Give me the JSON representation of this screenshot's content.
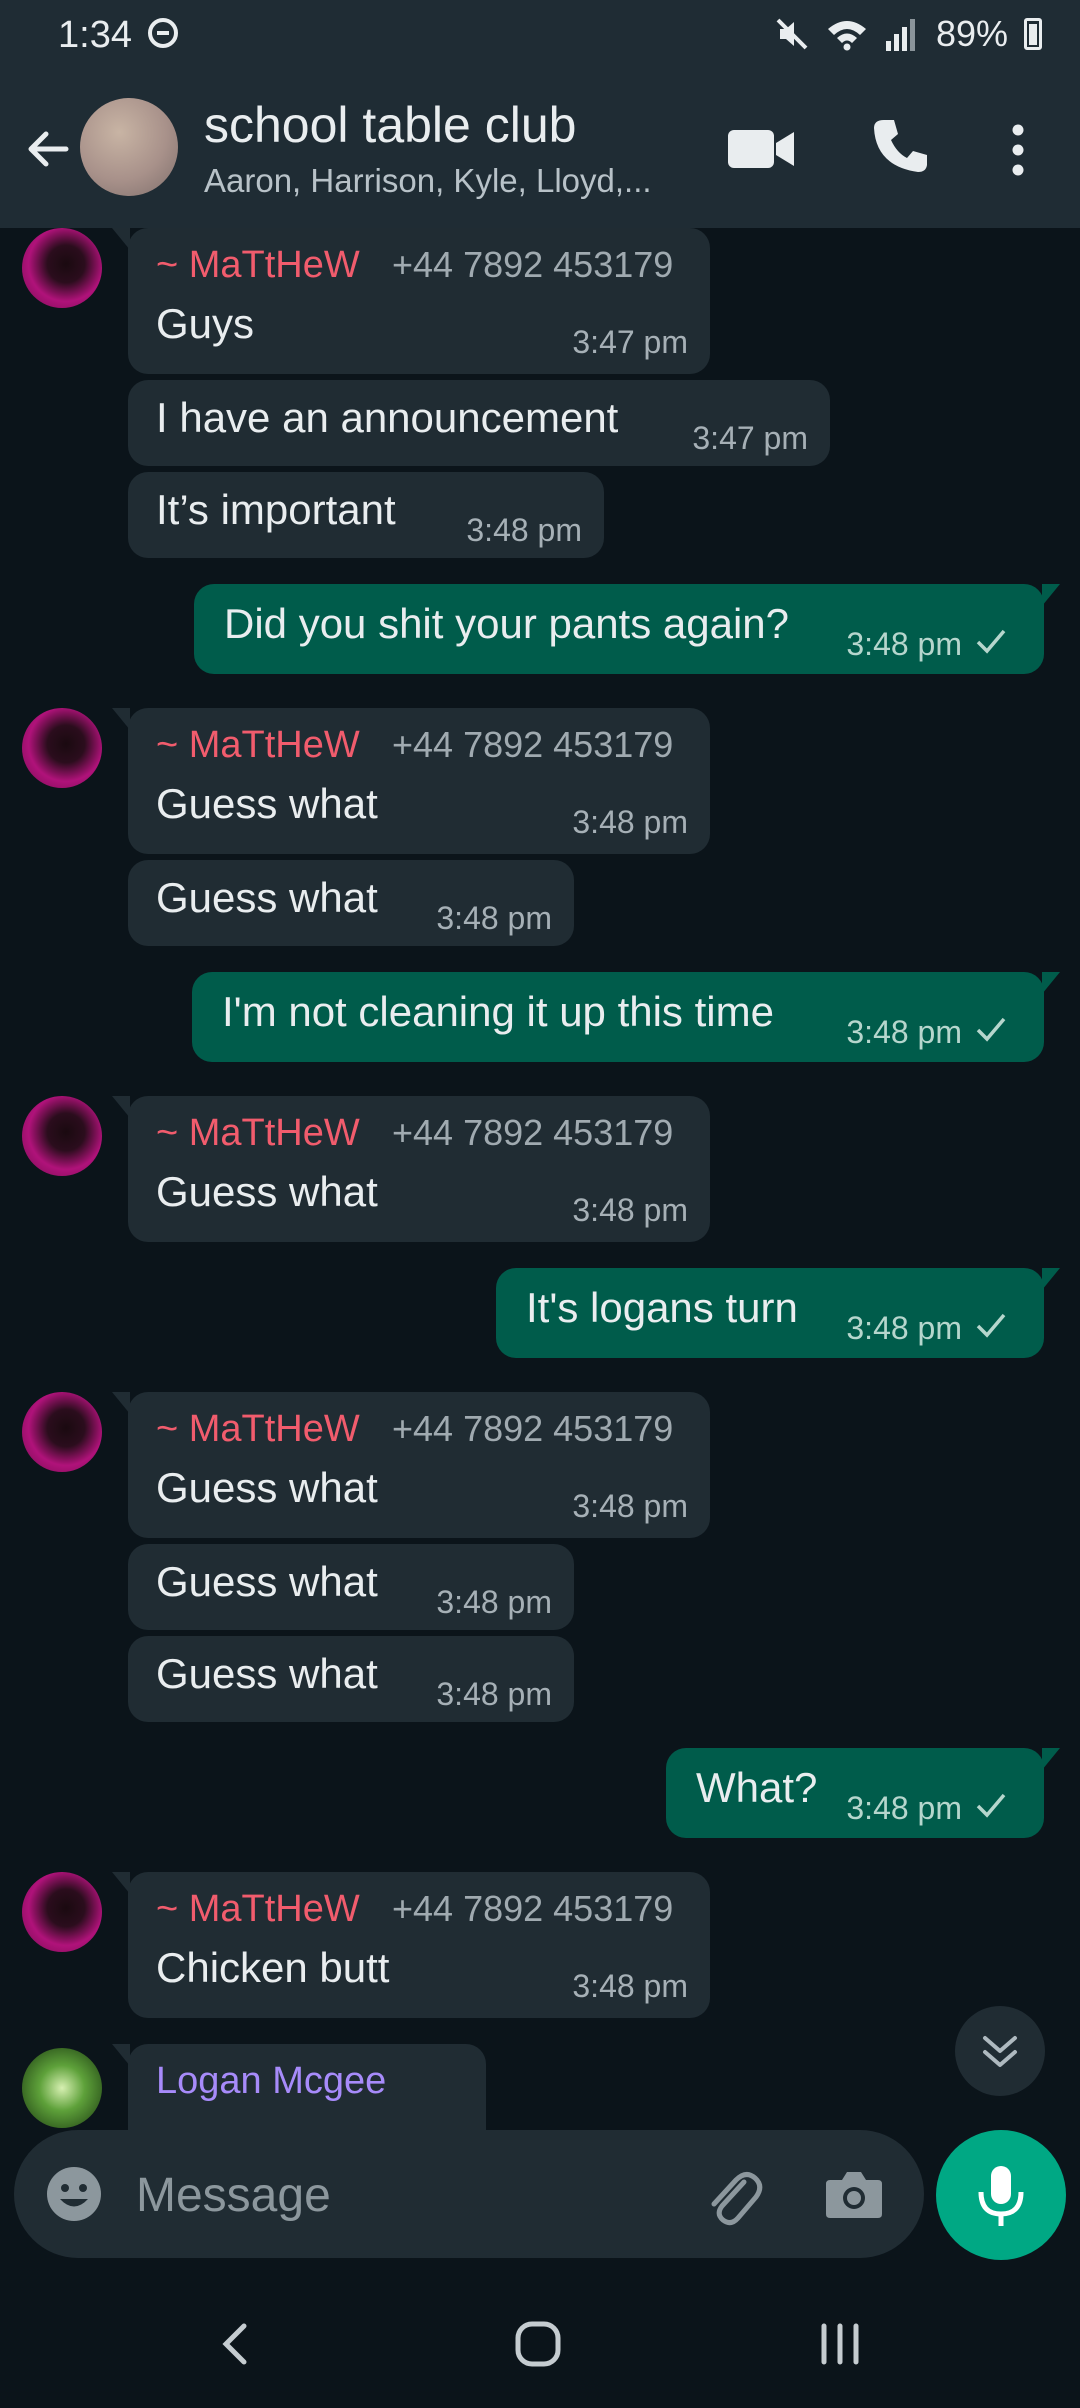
{
  "status_bar": {
    "time": "1:34",
    "battery": "89%"
  },
  "header": {
    "title": "school table club",
    "subtitle": "Aaron, Harrison, Kyle, Lloyd,..."
  },
  "messages": [
    {
      "dir": "in",
      "sender": "~ MaTtHeW",
      "phone": "+44 7892 453179",
      "text": "Guys",
      "time": "3:47 pm"
    },
    {
      "dir": "in",
      "text": "I have an announcement",
      "time": "3:47 pm"
    },
    {
      "dir": "in",
      "text": "It’s important",
      "time": "3:48 pm"
    },
    {
      "dir": "out",
      "text": "Did you shit your pants again?",
      "time": "3:48 pm"
    },
    {
      "dir": "in",
      "sender": "~ MaTtHeW",
      "phone": "+44 7892 453179",
      "text": "Guess what",
      "time": "3:48 pm"
    },
    {
      "dir": "in",
      "text": "Guess what",
      "time": "3:48 pm"
    },
    {
      "dir": "out",
      "text": "I'm not cleaning it up this time",
      "time": "3:48 pm"
    },
    {
      "dir": "in",
      "sender": "~ MaTtHeW",
      "phone": "+44 7892 453179",
      "text": "Guess what",
      "time": "3:48 pm"
    },
    {
      "dir": "out",
      "text": "It's logans turn",
      "time": "3:48 pm"
    },
    {
      "dir": "in",
      "sender": "~ MaTtHeW",
      "phone": "+44 7892 453179",
      "text": "Guess what",
      "time": "3:48 pm"
    },
    {
      "dir": "in",
      "text": "Guess what",
      "time": "3:48 pm"
    },
    {
      "dir": "in",
      "text": "Guess what",
      "time": "3:48 pm"
    },
    {
      "dir": "out",
      "text": "What?",
      "time": "3:48 pm"
    },
    {
      "dir": "in",
      "sender": "~ MaTtHeW",
      "phone": "+44 7892 453179",
      "text": "Chicken butt",
      "time": "3:48 pm"
    }
  ],
  "partial_sender": "Logan Mcgee",
  "input": {
    "placeholder": "Message"
  },
  "colors": {
    "incoming": "#202c33",
    "outgoing": "#005c4b",
    "accent": "#00a884",
    "sender_name": "#f15c6d"
  }
}
